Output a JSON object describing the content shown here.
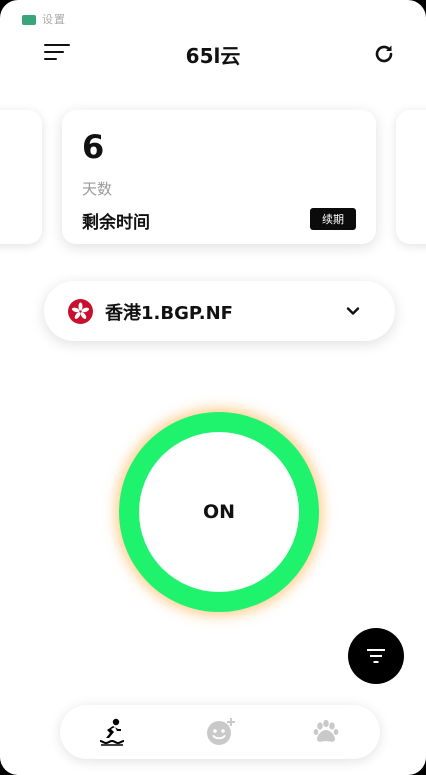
{
  "status_bar": {
    "text": "设置"
  },
  "header": {
    "title": "65l云",
    "menu_icon": "menu-lines-icon",
    "refresh_icon": "refresh-icon"
  },
  "card": {
    "number": "6",
    "unit": "天数",
    "label": "剩余时间",
    "renew_button": "续期"
  },
  "server": {
    "name": "香港1.BGP.NF",
    "flag_icon": "hong-kong-flag-icon",
    "dropdown_icon": "chevron-down-icon"
  },
  "power": {
    "label": "ON",
    "ring_color": "#1ff36e",
    "glow_color": "#ffaa3c"
  },
  "fab": {
    "icon": "filter-icon"
  },
  "bottom_nav": [
    {
      "icon": "surf-icon",
      "active": true
    },
    {
      "icon": "face-add-icon",
      "active": false
    },
    {
      "icon": "paw-icon",
      "active": false
    }
  ],
  "colors": {
    "accent": "#1ff36e",
    "primary": "#000000",
    "muted": "#9a9a9a"
  }
}
